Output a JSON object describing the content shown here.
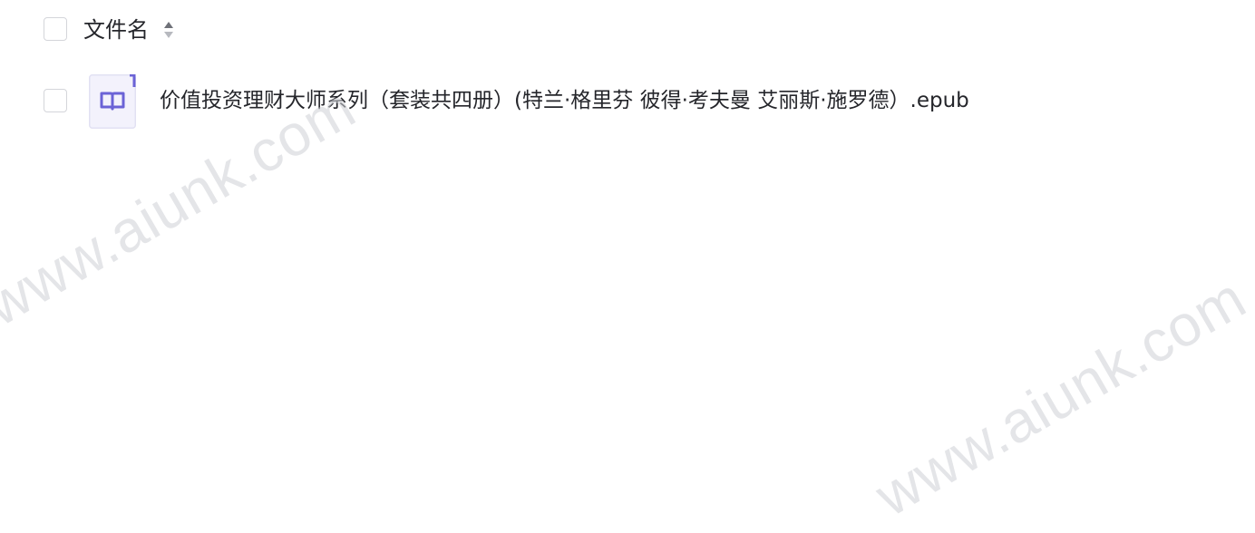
{
  "file_list": {
    "header": {
      "column_title": "文件名",
      "sort_icon": "sort-updown-icon"
    },
    "rows": [
      {
        "icon": "epub-book-icon",
        "name": "价值投资理财大师系列（套装共四册）(特兰·格里芬 彼得·考夫曼 艾丽斯·施罗德）.epub"
      }
    ]
  },
  "watermarks": [
    "www.aiunk.com",
    "www.aiunk.com"
  ],
  "colors": {
    "text": "#25262b",
    "checkbox_border": "#d4d5da",
    "icon_accent": "#6b63d6",
    "icon_bg": "#eeedfb",
    "watermark": "#cfd1d6"
  }
}
